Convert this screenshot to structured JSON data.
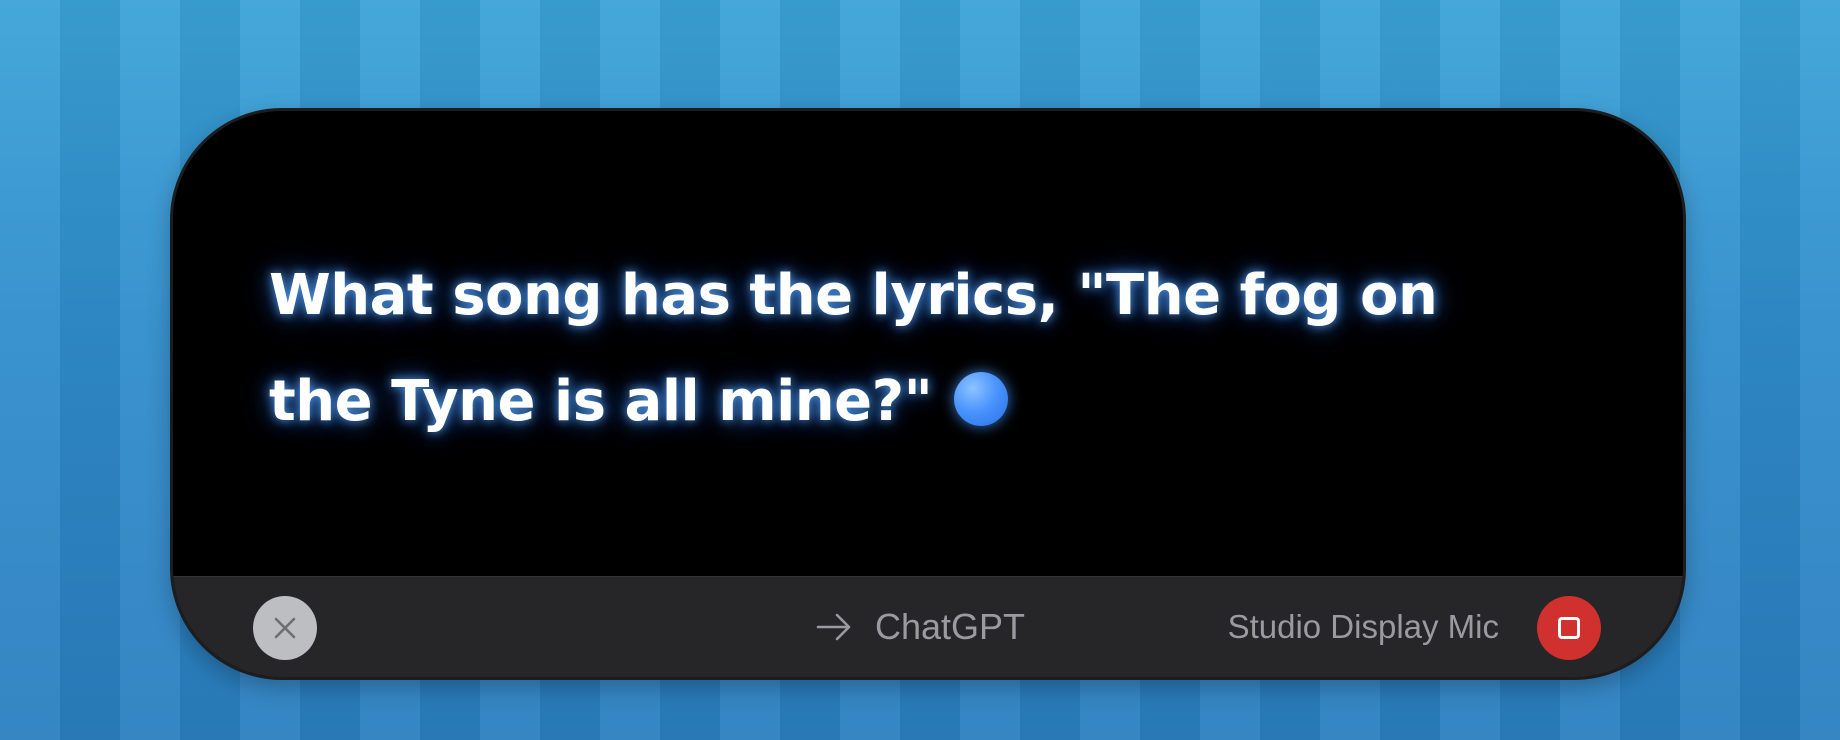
{
  "transcript": {
    "text": "What song has the lyrics, \"The fog on the Tyne is all mine?\""
  },
  "footer": {
    "close_icon": "close-icon",
    "target_icon": "arrow-right-icon",
    "target_label": "ChatGPT",
    "mic_label": "Studio Display Mic",
    "stop_icon": "stop-icon"
  },
  "colors": {
    "panel": "#000000",
    "footer": "#262628",
    "accent_dot": "#4b95ff",
    "stop_button": "#d0302e",
    "close_button": "#bdbec2"
  }
}
